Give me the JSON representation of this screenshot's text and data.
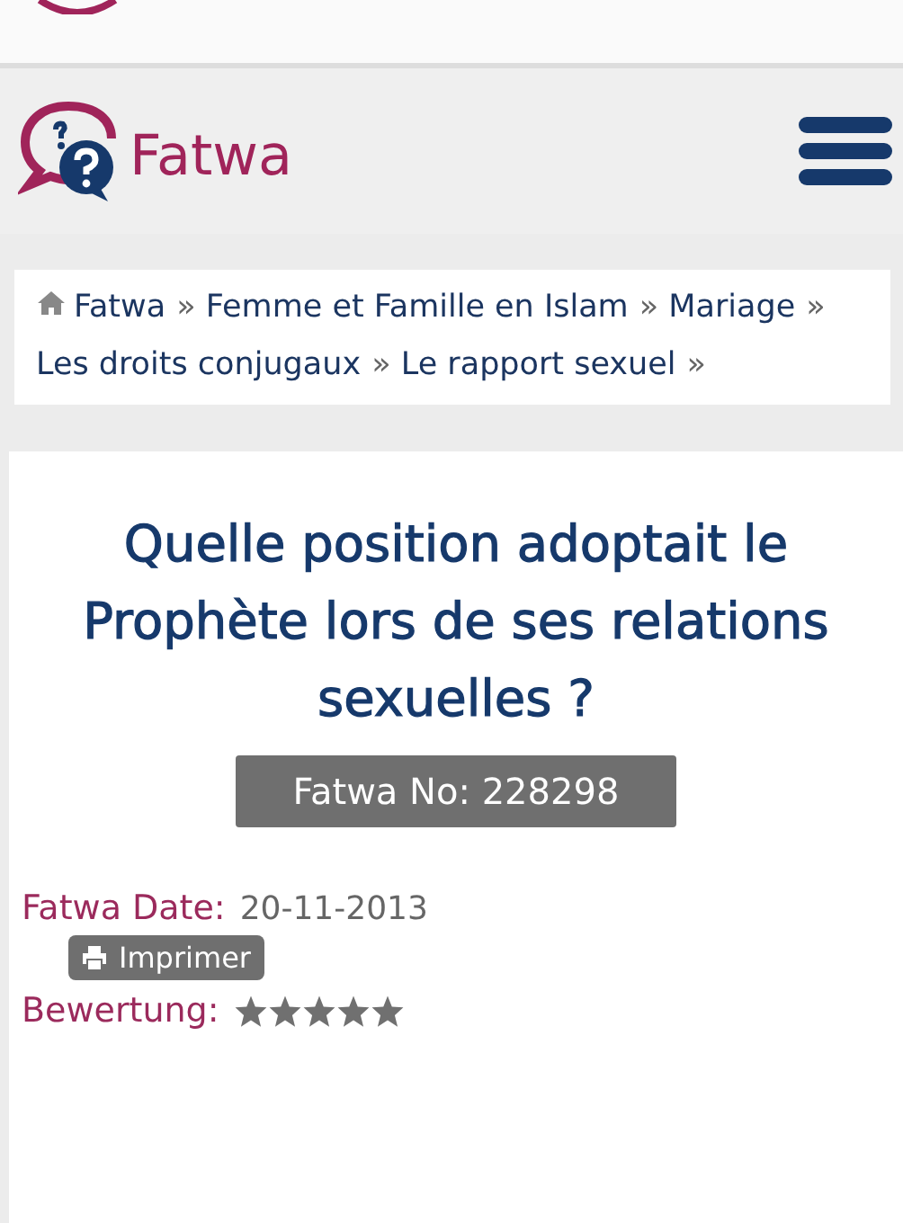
{
  "header": {
    "logo_text": "Fatwa"
  },
  "breadcrumb": [
    {
      "label": "Fatwa",
      "sep": "»"
    },
    {
      "label": "Femme et Famille en Islam",
      "sep": "»"
    },
    {
      "label": "Mariage",
      "sep": "»"
    },
    {
      "label": "Les droits conjugaux",
      "sep": "»"
    },
    {
      "label": "Le rapport sexuel",
      "sep": "»"
    }
  ],
  "title": "Quelle position adoptait le Prophète lors de ses relations sexuelles ?",
  "fatwa_no": "Fatwa No: 228298",
  "date_label": "Fatwa Date:",
  "date": "20-11-2013",
  "print_button": "Imprimer",
  "rating_label": "Bewertung:",
  "stars": 5
}
